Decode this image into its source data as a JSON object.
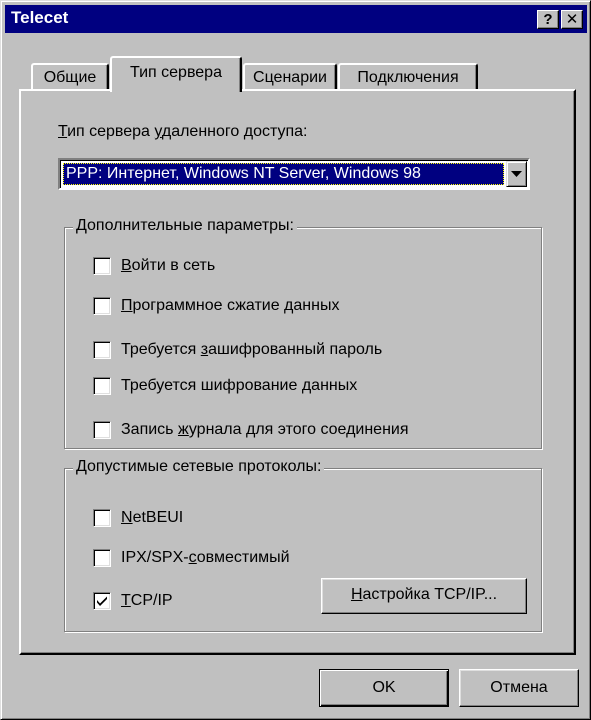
{
  "window": {
    "title": "Telecet"
  },
  "titlebar_buttons": {
    "help": "?",
    "close": "✕"
  },
  "tabs": [
    {
      "label": "Общие"
    },
    {
      "label": "Тип сервера"
    },
    {
      "label": "Сценарии"
    },
    {
      "label": "Подключения"
    }
  ],
  "active_tab": "Тип сервера",
  "server_type": {
    "label_hotkey": "Т",
    "label_rest": "ип сервера ",
    "label_hotkey2": "у",
    "label_rest2": "даленного доступа:",
    "selected": "PPP: Интернет, Windows NT Server, Windows 98"
  },
  "advanced": {
    "caption": "Дополнительные параметры:",
    "options": [
      {
        "pre": "",
        "key": "В",
        "post": "ойти в сеть",
        "checked": false
      },
      {
        "pre": "",
        "key": "П",
        "post": "рограммное сжатие данных",
        "checked": false
      },
      {
        "pre": "Требуется ",
        "key": "з",
        "post": "ашифрованный пароль",
        "checked": false
      },
      {
        "pre": "Требуется шифрование ",
        "key": "д",
        "post": "анных",
        "checked": false
      },
      {
        "pre": "Запись ",
        "key": "ж",
        "post": "урнала для этого соединения",
        "checked": false
      }
    ]
  },
  "protocols": {
    "caption": "Допустимые сетевые протоколы:",
    "options": [
      {
        "pre": "",
        "key": "N",
        "post": "etBEUI",
        "checked": false
      },
      {
        "pre": "IPX/SPX-",
        "key": "с",
        "post": "овместимый",
        "checked": false
      },
      {
        "pre": "",
        "key": "T",
        "post": "CP/IP",
        "checked": true
      }
    ],
    "tcpip_settings": {
      "key": "Н",
      "post": "астройка TCP/IP..."
    }
  },
  "buttons": {
    "ok": "OK",
    "cancel": "Отмена"
  },
  "colors": {
    "titlebar": "#000080",
    "face": "#c0c0c0",
    "selection": "#000080"
  },
  "icons": {
    "dropdown": "chevron-down-icon",
    "check": "check-icon"
  }
}
